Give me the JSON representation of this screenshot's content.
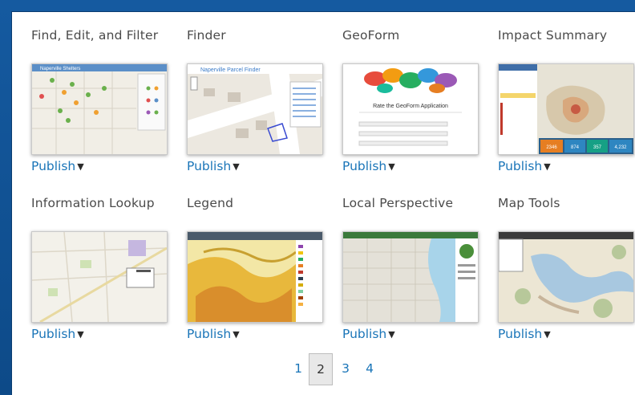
{
  "templates": [
    {
      "title": "Find, Edit, and Filter",
      "action": "Publish",
      "thumb": "naperville-shelters-map"
    },
    {
      "title": "Finder",
      "action": "Publish",
      "thumb": "naperville-parcel-finder-map"
    },
    {
      "title": "GeoForm",
      "action": "Publish",
      "thumb": "geoform-rate-app"
    },
    {
      "title": "Impact Summary",
      "action": "Publish",
      "thumb": "impact-summary-map"
    },
    {
      "title": "Information Lookup",
      "action": "Publish",
      "thumb": "information-lookup-map"
    },
    {
      "title": "Legend",
      "action": "Publish",
      "thumb": "soil-survey-legend-map"
    },
    {
      "title": "Local Perspective",
      "action": "Publish",
      "thumb": "local-perspective-map"
    },
    {
      "title": "Map Tools",
      "action": "Publish",
      "thumb": "map-tools-trails-map"
    }
  ],
  "thumb_text": {
    "shelters": "Naperville Shelters",
    "parcel": "Naperville Parcel Finder",
    "geoform_title": "Rate the GeoForm Application",
    "impact_stats": [
      "2346",
      "874",
      "357",
      "4,232"
    ]
  },
  "caret_icon": "caret-down-icon",
  "pagination": {
    "pages": [
      "1",
      "2",
      "3",
      "4"
    ],
    "current": "2"
  },
  "colors": {
    "frame": "#0f4c8a",
    "link": "#1a75b8",
    "title": "#4a4a4a"
  }
}
